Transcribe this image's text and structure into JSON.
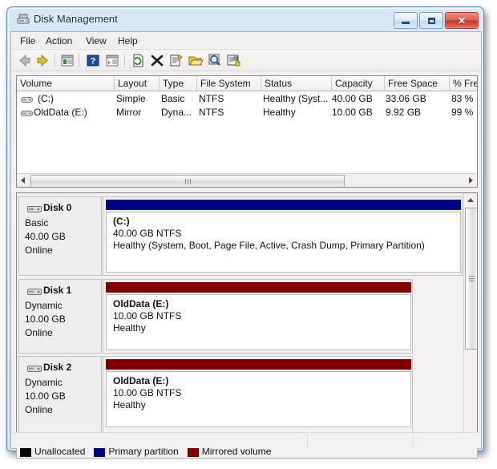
{
  "window": {
    "title": "Disk Management",
    "title_icon": "disk-drive-icon",
    "buttons": {
      "minimize": "Minimize",
      "maximize": "Maximize",
      "close": "✕"
    }
  },
  "menu": {
    "items": [
      "File",
      "Action",
      "View",
      "Help"
    ]
  },
  "toolbar": {
    "items": [
      "back-arrow-icon",
      "forward-arrow-icon",
      "show-hide-console-tree-icon",
      "help-icon",
      "show-hide-action-pane-icon",
      "refresh-icon",
      "delete-icon",
      "properties-icon",
      "open-icon",
      "find-icon",
      "rescan-disks-icon"
    ]
  },
  "volume_list": {
    "columns": [
      "Volume",
      "Layout",
      "Type",
      "File System",
      "Status",
      "Capacity",
      "Free Space",
      "% Fre"
    ],
    "rows": [
      {
        "icon": "volume-icon",
        "volume": "(C:)",
        "layout": "Simple",
        "type": "Basic",
        "file_system": "NTFS",
        "status": "Healthy (Syst...",
        "capacity": "40.00 GB",
        "free_space": "33.06 GB",
        "percent_free": "83 %"
      },
      {
        "icon": "volume-icon",
        "volume": "OldData (E:)",
        "layout": "Mirror",
        "type": "Dyna...",
        "file_system": "NTFS",
        "status": "Healthy",
        "capacity": "10.00 GB",
        "free_space": "9.92 GB",
        "percent_free": "99 %"
      }
    ]
  },
  "disks": [
    {
      "name": "Disk 0",
      "kind": "Basic",
      "size": "40.00 GB",
      "state": "Online",
      "bar_color": "#000080",
      "partition": {
        "label": "(C:)",
        "size_fs": "40.00 GB NTFS",
        "status": "Healthy (System, Boot, Page File, Active, Crash Dump, Primary Partition)"
      }
    },
    {
      "name": "Disk 1",
      "kind": "Dynamic",
      "size": "10.00 GB",
      "state": "Online",
      "bar_color": "#800000",
      "partition": {
        "label": "OldData  (E:)",
        "size_fs": "10.00 GB NTFS",
        "status": "Healthy"
      }
    },
    {
      "name": "Disk 2",
      "kind": "Dynamic",
      "size": "10.00 GB",
      "state": "Online",
      "bar_color": "#800000",
      "partition": {
        "label": "OldData  (E:)",
        "size_fs": "10.00 GB NTFS",
        "status": "Healthy"
      }
    }
  ],
  "legend": [
    {
      "label": "Unallocated",
      "color": "#000000"
    },
    {
      "label": "Primary partition",
      "color": "#000080"
    },
    {
      "label": "Mirrored volume",
      "color": "#800000"
    }
  ],
  "status_bar": {
    "panes": [
      "",
      "",
      ""
    ]
  }
}
